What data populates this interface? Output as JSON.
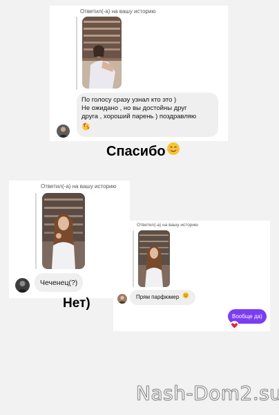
{
  "post1": {
    "reply_label": "Ответил(-а) на вашу историю",
    "message_lines": [
      "По голосу сразу узнал кто это )",
      "Не ожидано  , но вы достойны друг",
      "друга , хороший парень ) поздравляю"
    ],
    "emoji": "face-with-party-horn"
  },
  "caption1": {
    "text": "Спасибо",
    "emoji": "smiling-face"
  },
  "post2": {
    "reply_label": "Ответил(-а) на вашу историю",
    "message": "Чеченец(?)"
  },
  "caption2": {
    "text": "Нет)"
  },
  "post3": {
    "reply_label": "Ответил(-а) на вашу историю",
    "message": "Прям парфюмер",
    "message_emoji": "grinning-face",
    "my_reply": "Вообще да)",
    "reaction": "heart",
    "my_bubble_color": "#7b3df2"
  },
  "watermark": {
    "text": "Nash-Dom2.su"
  }
}
